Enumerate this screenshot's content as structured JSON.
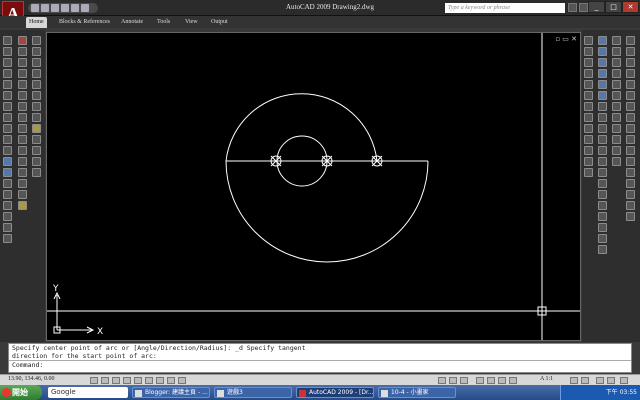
{
  "app": {
    "logo_letter": "A",
    "title": "AutoCAD 2009  Drawing2.dwg",
    "search_placeholder": "Type a keyword or phrase",
    "window_controls": [
      "_",
      "□",
      "✕"
    ]
  },
  "ribbon": {
    "tabs": [
      "Home",
      "Blocks & References",
      "Annotate",
      "Tools",
      "View",
      "Output"
    ],
    "active_tab": "Home"
  },
  "viewport": {
    "controls": "▫ ▭ ✕",
    "ucs": {
      "x_label": "X",
      "y_label": "Y"
    }
  },
  "command": {
    "history": [
      "Specify center point of arc or [Angle/Direction/Radius]: _d Specify tangent",
      "direction for the start point of arc:"
    ],
    "prompt": "Command:"
  },
  "status": {
    "coords": "13.90, 134.46, 0.00",
    "scale": "A 1:1"
  },
  "taskbar": {
    "start_label": "開始",
    "search_text": "Google",
    "tasks": [
      {
        "label": "Blogger: 建議主頁 - ...",
        "active": false
      },
      {
        "label": "遊戲3",
        "active": false
      },
      {
        "label": "AutoCAD 2009 - [Dr...",
        "active": true
      },
      {
        "label": "10-4 - 小畫家",
        "active": false
      }
    ],
    "clock": "下午 03:55"
  },
  "colors": {
    "canvas_bg": "#000000",
    "geometry": "#ffffff",
    "snap_marker": "#ffffff"
  }
}
